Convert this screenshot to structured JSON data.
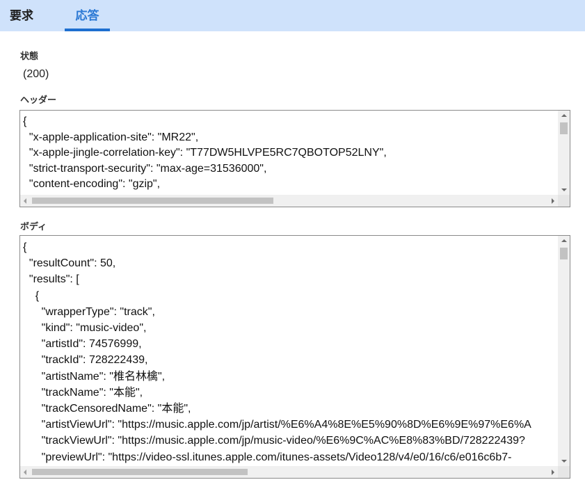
{
  "tabs": {
    "request": "要求",
    "response": "応答"
  },
  "status": {
    "label": "状態",
    "value": "(200)"
  },
  "headers": {
    "label": "ヘッダー",
    "text": "{\n  \"x-apple-application-site\": \"MR22\",\n  \"x-apple-jingle-correlation-key\": \"T77DW5HLVPE5RC7QBOTOP52LNY\",\n  \"strict-transport-security\": \"max-age=31536000\",\n  \"content-encoding\": \"gzip\","
  },
  "body": {
    "label": "ボディ",
    "text": "{\n  \"resultCount\": 50,\n  \"results\": [\n    {\n      \"wrapperType\": \"track\",\n      \"kind\": \"music-video\",\n      \"artistId\": 74576999,\n      \"trackId\": 728222439,\n      \"artistName\": \"椎名林檎\",\n      \"trackName\": \"本能\",\n      \"trackCensoredName\": \"本能\",\n      \"artistViewUrl\": \"https://music.apple.com/jp/artist/%E6%A4%8E%E5%90%8D%E6%9E%97%E6%A\n      \"trackViewUrl\": \"https://music.apple.com/jp/music-video/%E6%9C%AC%E8%83%BD/728222439?\n      \"previewUrl\": \"https://video-ssl.itunes.apple.com/itunes-assets/Video128/v4/e0/16/c6/e016c6b7-"
  }
}
